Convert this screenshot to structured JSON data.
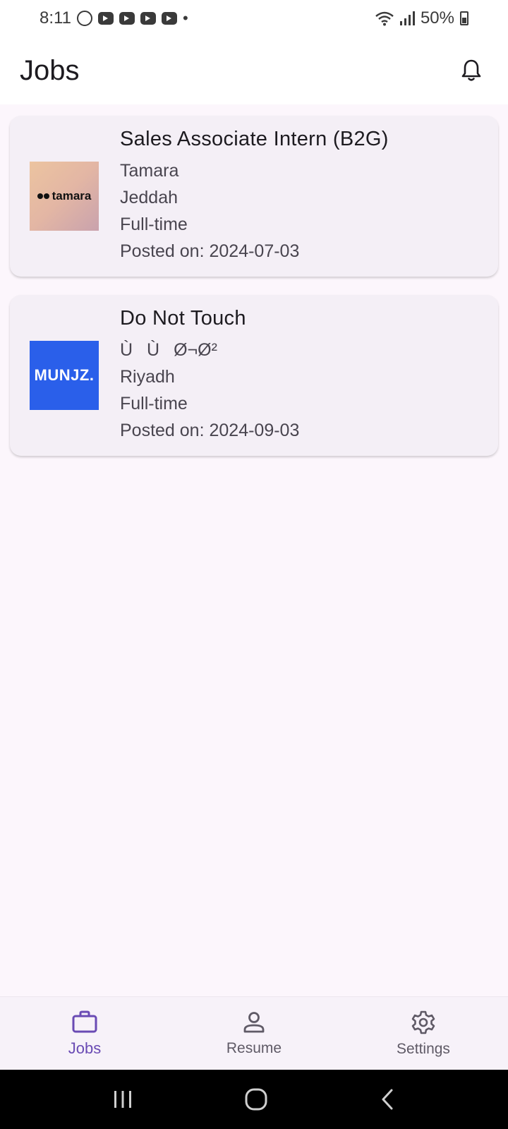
{
  "status_bar": {
    "time": "8:11",
    "battery": "50%"
  },
  "header": {
    "title": "Jobs"
  },
  "jobs": [
    {
      "title": "Sales Associate Intern (B2G)",
      "company": "Tamara",
      "location": "Jeddah",
      "type": "Full-time",
      "posted": "Posted on: 2024-07-03",
      "logo_text": "tamara"
    },
    {
      "title": "Do Not Touch",
      "company": "ÙÙØ¬Ø²",
      "location": "Riyadh",
      "type": "Full-time",
      "posted": "Posted on: 2024-09-03",
      "logo_text": "MUNJZ."
    }
  ],
  "bottom_nav": {
    "items": [
      {
        "label": "Jobs",
        "icon": "briefcase-icon",
        "active": true
      },
      {
        "label": "Resume",
        "icon": "person-icon",
        "active": false
      },
      {
        "label": "Settings",
        "icon": "gear-icon",
        "active": false
      }
    ]
  },
  "colors": {
    "accent": "#6a4bb4",
    "background": "#fcf6fc",
    "card": "#f4eff6",
    "munjz_brand": "#2a5fea"
  }
}
